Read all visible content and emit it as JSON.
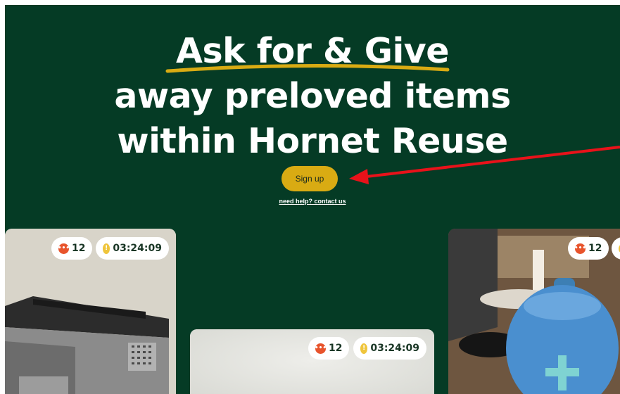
{
  "hero": {
    "title_line1": "Ask for & Give",
    "title_line2": "away preloved items",
    "title_line3": "within Hornet Reuse",
    "signup_label": "Sign up",
    "help_link": "need help? contact us"
  },
  "cards": [
    {
      "image": "printer",
      "messages": "12",
      "timer": "03:24:09"
    },
    {
      "image": "blank",
      "messages": "12",
      "timer": "03:24:09"
    },
    {
      "image": "speaker",
      "messages": "12",
      "timer": ""
    }
  ],
  "colors": {
    "background": "#053b25",
    "accent": "#d9ab13",
    "arrow": "#e8121a"
  },
  "icons": {
    "messages": "chat-bubble-icon",
    "timer": "clock-icon"
  }
}
